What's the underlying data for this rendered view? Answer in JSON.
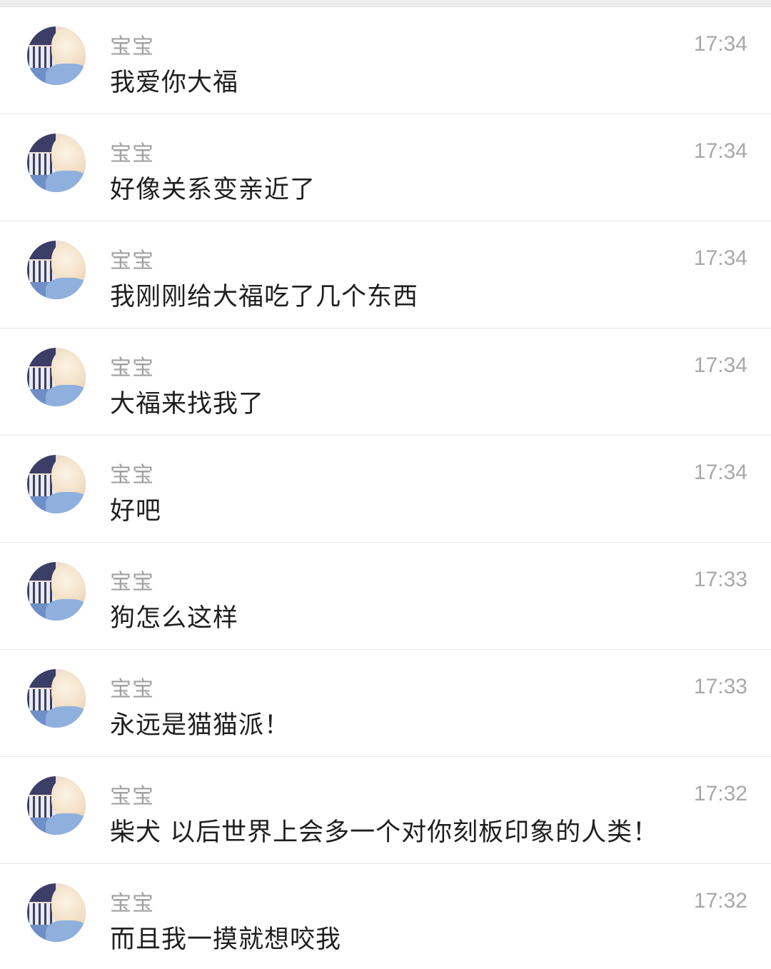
{
  "messages": [
    {
      "sender": "宝宝",
      "text": "我爱你大福",
      "time": "17:34"
    },
    {
      "sender": "宝宝",
      "text": "好像关系变亲近了",
      "time": "17:34"
    },
    {
      "sender": "宝宝",
      "text": "我刚刚给大福吃了几个东西",
      "time": "17:34"
    },
    {
      "sender": "宝宝",
      "text": "大福来找我了",
      "time": "17:34"
    },
    {
      "sender": "宝宝",
      "text": "好吧",
      "time": "17:34"
    },
    {
      "sender": "宝宝",
      "text": "狗怎么这样",
      "time": "17:33"
    },
    {
      "sender": "宝宝",
      "text": "永远是猫猫派！",
      "time": "17:33"
    },
    {
      "sender": "宝宝",
      "text": "柴犬 以后世界上会多一个对你刻板印象的人类！",
      "time": "17:32"
    },
    {
      "sender": "宝宝",
      "text": "而且我一摸就想咬我",
      "time": "17:32"
    }
  ]
}
